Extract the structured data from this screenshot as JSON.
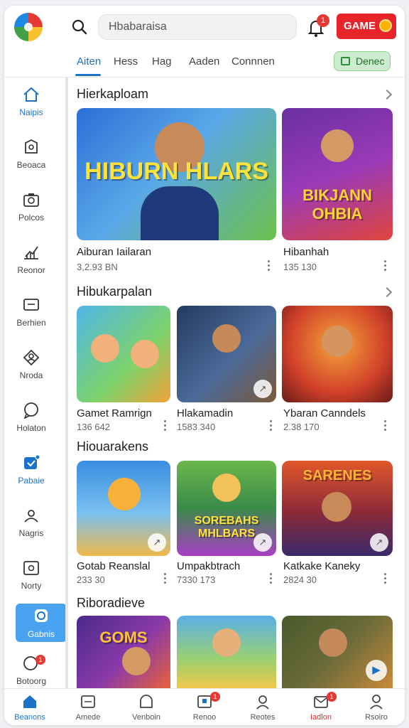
{
  "topbar": {
    "search_placeholder": "Hbabaraisa",
    "bell_badge": "1",
    "game_button": "GAME"
  },
  "tabs": [
    {
      "label": "Aiten",
      "active": true
    },
    {
      "label": "Hess"
    },
    {
      "label": "Hag"
    },
    {
      "label": "Aaden"
    },
    {
      "label": "Connnen"
    }
  ],
  "demo_button": "Denec",
  "sidebar": [
    {
      "label": "Naipis",
      "icon": "home-icon",
      "active": true
    },
    {
      "label": "Beoaca",
      "icon": "shield-icon"
    },
    {
      "label": "Polcos",
      "icon": "camera-icon"
    },
    {
      "label": "Reonor",
      "icon": "chart-icon"
    },
    {
      "label": "Berhien",
      "icon": "message-icon"
    },
    {
      "label": "Nroda",
      "icon": "user-icon"
    },
    {
      "label": "Holaton",
      "icon": "chat-icon"
    },
    {
      "label": "Pabaie",
      "icon": "tag-icon",
      "active": true
    },
    {
      "label": "Nagris",
      "icon": "group-icon"
    },
    {
      "label": "Norty",
      "icon": "settings-icon"
    },
    {
      "label": "Gabnis",
      "icon": "disc-icon",
      "highlight": true
    },
    {
      "label": "Botoorg",
      "icon": "bubble-icon",
      "badge": "1"
    }
  ],
  "sections": [
    {
      "title": "Hierkaploam",
      "cards": [
        {
          "title": "Aiburan Iailaran",
          "meta": "3,2.93 BN",
          "art": "HIBURN HLARS",
          "colors": [
            "#2b6fd6",
            "#6cc04a"
          ]
        },
        {
          "title": "Hibanhah",
          "meta": "135 130",
          "art": "BIKJANN OHBIA",
          "colors": [
            "#6a2fa3",
            "#e0453c"
          ]
        }
      ]
    },
    {
      "title": "Hibukarpalan",
      "cards": [
        {
          "title": "Gamet Ramrign",
          "meta": "136 642",
          "art": "",
          "colors": [
            "#4fb7e8",
            "#f3a13a"
          ]
        },
        {
          "title": "Hlakamadin",
          "meta": "1583 340",
          "art": "",
          "colors": [
            "#233a5e",
            "#7a5a3a"
          ]
        },
        {
          "title": "Ybaran Canndels",
          "meta": "2.38 170",
          "art": "",
          "colors": [
            "#d1412a",
            "#f6a53a"
          ]
        }
      ]
    },
    {
      "title": "Hiouarakens",
      "cards": [
        {
          "title": "Gotab Reanslal",
          "meta": "233 30",
          "art": "",
          "colors": [
            "#3a8ee0",
            "#f0b94a"
          ]
        },
        {
          "title": "Umpakbtrach",
          "meta": "7330 173",
          "art": "SOREBAHS MHLBARS",
          "colors": [
            "#6ab84a",
            "#a73fc4"
          ]
        },
        {
          "title": "Katkake Kaneky",
          "meta": "2824 30",
          "art": "SARENES",
          "colors": [
            "#e0572a",
            "#3a2a6a"
          ]
        }
      ]
    },
    {
      "title": "Riboradieve",
      "cards": [
        {
          "title": "",
          "meta": "",
          "art": "GOMS",
          "colors": [
            "#4a2a8a",
            "#e8623a"
          ]
        },
        {
          "title": "",
          "meta": "",
          "art": "",
          "colors": [
            "#5ab0e8",
            "#f0c84a"
          ]
        },
        {
          "title": "",
          "meta": "",
          "art": "",
          "colors": [
            "#4a5a2a",
            "#c88a3a"
          ]
        }
      ]
    }
  ],
  "bottom_nav": [
    {
      "label": "Beanons",
      "icon": "home-icon",
      "active": true
    },
    {
      "label": "Amede",
      "icon": "image-icon"
    },
    {
      "label": "Venboin",
      "icon": "chat-icon"
    },
    {
      "label": "Renoo",
      "icon": "inbox-icon",
      "badge": "1"
    },
    {
      "label": "Reotes",
      "icon": "search-icon"
    },
    {
      "label": "Iadlon",
      "icon": "mail-icon",
      "badge": "1",
      "red": true
    },
    {
      "label": "Rsoiro",
      "icon": "profile-icon"
    }
  ],
  "colors": {
    "accent": "#1a73c9",
    "game_red": "#e8242b",
    "demo_green": "#cdeccf"
  }
}
